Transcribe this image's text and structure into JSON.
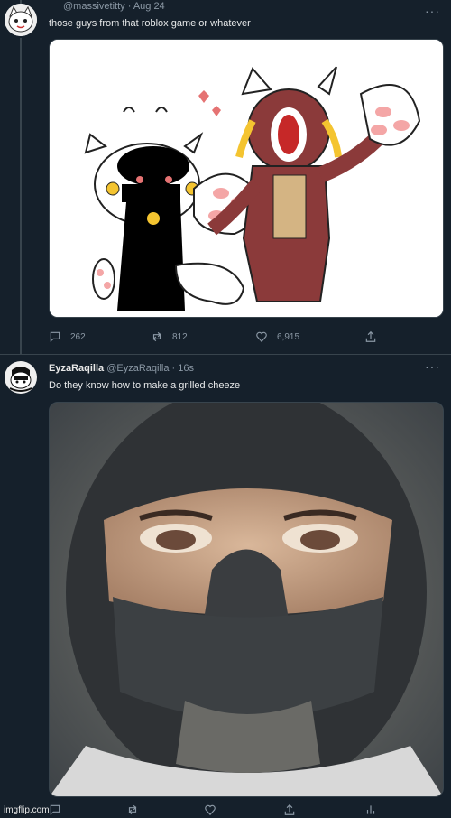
{
  "tweet1": {
    "handle": "@massivetitty",
    "separator": "·",
    "date": "Aug 24",
    "text": "those guys from that roblox game or whatever",
    "replies": "262",
    "retweets": "812",
    "likes": "6,915"
  },
  "tweet2": {
    "display_name": "EyzaRaqilla",
    "handle": "@EyzaRaqilla",
    "separator": "·",
    "time": "16s",
    "text": "Do they know how to make a grilled cheeze"
  },
  "icons": {
    "more": "more-dots-icon",
    "reply": "reply-bubble-icon",
    "retweet": "retweet-arrows-icon",
    "like": "heart-icon",
    "share": "share-upload-icon",
    "analytics": "analytics-bars-icon"
  },
  "more_glyph": "···",
  "watermark": "imgflip.com",
  "colors": {
    "background": "#15202b",
    "muted": "#8b98a5",
    "text": "#e7e9ea"
  }
}
